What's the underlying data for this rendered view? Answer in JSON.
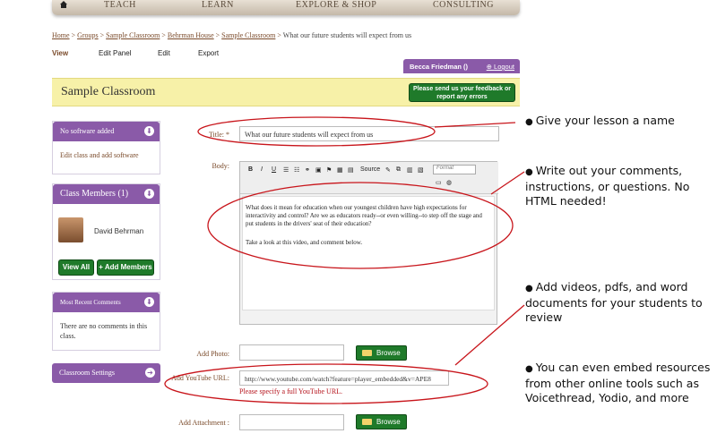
{
  "topnav": {
    "items": [
      "TEACH",
      "LEARN",
      "EXPLORE & SHOP",
      "CONSULTING"
    ]
  },
  "breadcrumb": {
    "items": [
      "Home",
      "Groups",
      "Sample Classroom",
      "Behrman House",
      "Sample Classroom"
    ],
    "current": "What our future students will expect from us",
    "sep": ">"
  },
  "subtabs": [
    "View",
    "Edit Panel",
    "Edit",
    "Export"
  ],
  "user": {
    "name": "Becca Friedman ()",
    "logout": "Logout"
  },
  "page": {
    "title": "Sample Classroom",
    "feedback": "Please send us your feedback or report any errors"
  },
  "sidebar": {
    "software": {
      "header": "No software added",
      "link": "Edit class and add software"
    },
    "members": {
      "header": "Class Members (1)",
      "member": "David Behrman",
      "view_all": "View All",
      "add": "+ Add Members"
    },
    "comments": {
      "header": "Most Recent Comments",
      "body": "There are no comments in this class."
    },
    "settings": {
      "header": "Classroom Settings"
    }
  },
  "form": {
    "title_label": "Title: *",
    "title_value": "What our future students will expect from us",
    "body_label": "Body:",
    "toolbar_source": "Source",
    "toolbar_format": "Format",
    "body_p1": "What does it mean for education when our youngest children have high expectations for interactivity and control? Are we as educators ready--or even willing--to step off the stage and put students in the drivers' seat of their education?",
    "body_p2": "Take a look at this video, and comment below.",
    "photo_label": "Add Photo:",
    "youtube_label": "Add YouTube URL:",
    "youtube_value": "http://www.youtube.com/watch?feature=player_embedded&v=APE8",
    "youtube_error": "Please specify a full YouTube URL.",
    "attachment_label": "Add Attachment :",
    "browse": "Browse"
  },
  "annotations": [
    "Give your lesson a name",
    "Write out your comments, instructions, or questions. No HTML needed!",
    "Add videos, pdfs, and word documents for your students to review",
    "You can even embed resources from other online tools such as Voicethread, Yodio, and more"
  ],
  "colors": {
    "purple": "#8a5aa8",
    "green": "#1f7a2a",
    "yellow": "#f7f1a8",
    "red": "#c8151b"
  }
}
